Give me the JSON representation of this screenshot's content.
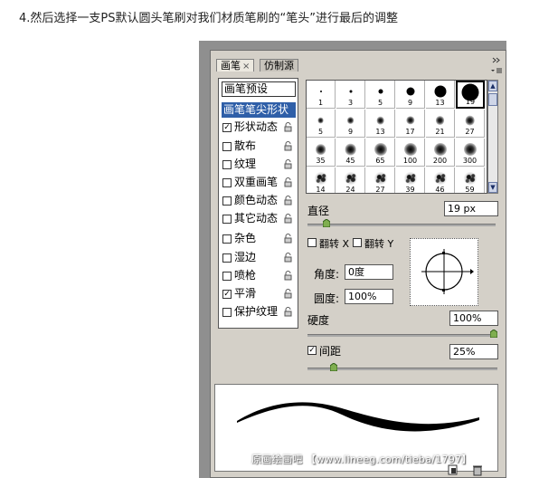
{
  "caption": "4.然后选择一支PS默认圆头笔刷对我们材质笔刷的“笔头”进行最后的调整",
  "panel": {
    "tabs": [
      {
        "label": "画笔",
        "close": "×",
        "active": true
      },
      {
        "label": "仿制源",
        "active": false
      }
    ],
    "menu_icon": "panel-menu-icon"
  },
  "brush_options": {
    "presets_label": "画笔预设",
    "tip_shape_label": "画笔笔尖形状",
    "items": [
      {
        "label": "形状动态",
        "checked": true
      },
      {
        "label": "散布",
        "checked": false
      },
      {
        "label": "纹理",
        "checked": false
      },
      {
        "label": "双重画笔",
        "checked": false
      },
      {
        "label": "颜色动态",
        "checked": false
      },
      {
        "label": "其它动态",
        "checked": false
      },
      {
        "label": "杂色",
        "checked": false
      },
      {
        "label": "湿边",
        "checked": false
      },
      {
        "label": "喷枪",
        "checked": false
      },
      {
        "label": "平滑",
        "checked": true
      },
      {
        "label": "保护纹理",
        "checked": false
      }
    ],
    "check_mark": "✓"
  },
  "brush_tips": [
    {
      "size": "1",
      "type": "hard"
    },
    {
      "size": "3",
      "type": "hard"
    },
    {
      "size": "5",
      "type": "hard"
    },
    {
      "size": "9",
      "type": "hard"
    },
    {
      "size": "13",
      "type": "hard"
    },
    {
      "size": "19",
      "type": "hard",
      "selected": true
    },
    {
      "size": "5",
      "type": "soft"
    },
    {
      "size": "9",
      "type": "soft"
    },
    {
      "size": "13",
      "type": "soft"
    },
    {
      "size": "17",
      "type": "soft"
    },
    {
      "size": "21",
      "type": "soft"
    },
    {
      "size": "27",
      "type": "soft"
    },
    {
      "size": "35",
      "type": "soft"
    },
    {
      "size": "45",
      "type": "soft"
    },
    {
      "size": "65",
      "type": "soft"
    },
    {
      "size": "100",
      "type": "soft"
    },
    {
      "size": "200",
      "type": "soft"
    },
    {
      "size": "300",
      "type": "soft"
    },
    {
      "size": "14",
      "type": "texture"
    },
    {
      "size": "24",
      "type": "texture"
    },
    {
      "size": "27",
      "type": "texture"
    },
    {
      "size": "39",
      "type": "texture"
    },
    {
      "size": "46",
      "type": "texture"
    },
    {
      "size": "59",
      "type": "texture"
    }
  ],
  "settings": {
    "diameter_label": "直径",
    "diameter_value": "19 px",
    "diameter_level": 0.1,
    "flip_x_label": "翻转 X",
    "flip_y_label": "翻转 Y",
    "angle_label": "角度:",
    "angle_value": "0度",
    "roundness_label": "圆度:",
    "roundness_value": "100%",
    "hardness_label": "硬度",
    "hardness_value": "100%",
    "hardness_level": 1.0,
    "spacing_label": "间距",
    "spacing_value": "25%",
    "spacing_checked": true,
    "spacing_level": 0.14
  },
  "watermark": "原画绘画吧 【www.lineeg.com/tieba/1797】",
  "colors": {
    "panel_bg": "#d4d0c8",
    "selection": "#2f5fa8",
    "slider_knob": "#7fae4f"
  }
}
